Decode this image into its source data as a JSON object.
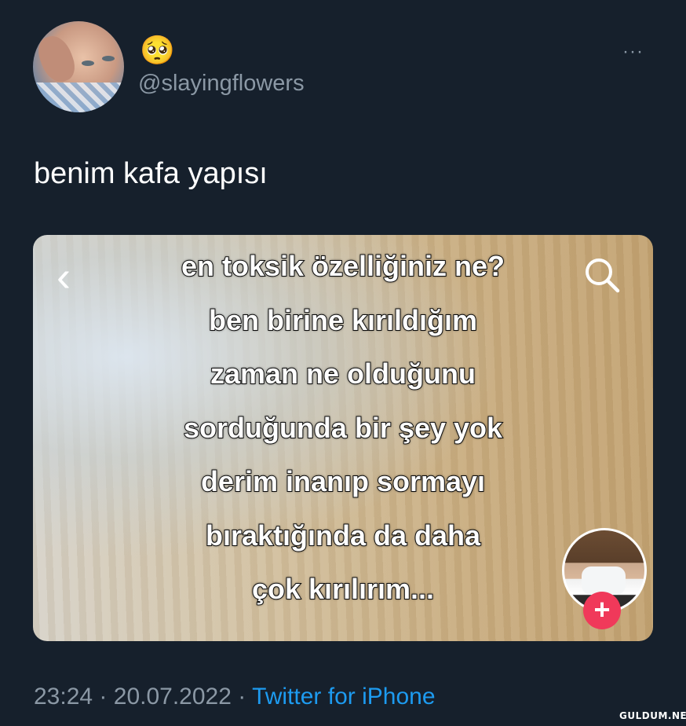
{
  "tweet": {
    "display_name": "🥺",
    "handle": "@slayingflowers",
    "more_label": "···",
    "text": "benim kafa yapısı",
    "time": "23:24",
    "separator": "·",
    "date": "20.07.2022",
    "source": "Twitter for iPhone"
  },
  "media": {
    "back_icon": "‹",
    "caption_lines": [
      "en toksik özelliğiniz ne?",
      "ben birine kırıldığım",
      "zaman ne olduğunu",
      "sorduğunda bir şey yok",
      "derim inanıp sormayı",
      "bıraktığında da daha",
      "çok kırılırım..."
    ],
    "follow_label": "+"
  },
  "watermark": "GULDUM.NET",
  "colors": {
    "background": "#16202c",
    "secondary_text": "#8b98a5",
    "link": "#1d9bf0",
    "follow": "#f0395a"
  }
}
